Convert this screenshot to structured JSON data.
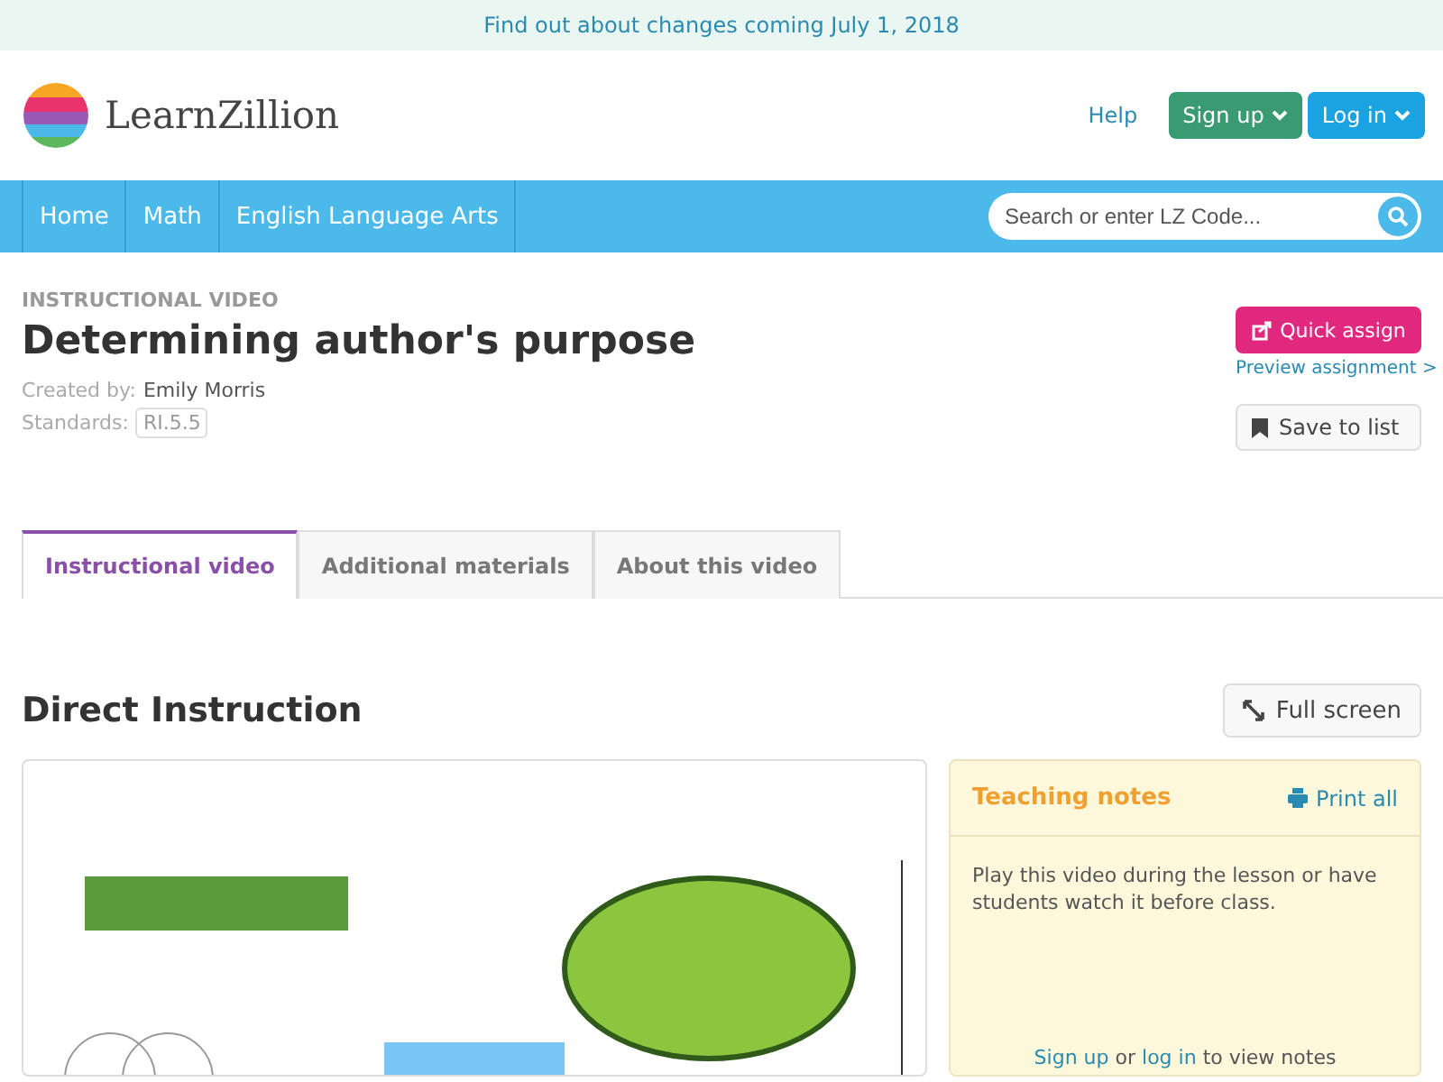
{
  "banner": {
    "text": "Find out about changes coming July 1, 2018"
  },
  "header": {
    "logo_text": "LearnZillion",
    "help": "Help",
    "signup": "Sign up",
    "login": "Log in"
  },
  "nav": {
    "items": [
      "Home",
      "Math",
      "English Language Arts"
    ],
    "search": {
      "placeholder": "Search or enter LZ Code..."
    }
  },
  "lesson": {
    "type": "INSTRUCTIONAL VIDEO",
    "title": "Determining author's purpose",
    "created_label": "Created by:",
    "author": "Emily Morris",
    "standards_label": "Standards:",
    "standard": "RI.5.5",
    "quick_assign": "Quick assign",
    "preview": "Preview assignment >",
    "save": "Save to list"
  },
  "tabs": [
    {
      "label": "Instructional video",
      "selected": true
    },
    {
      "label": "Additional materials",
      "selected": false
    },
    {
      "label": "About this video",
      "selected": false
    }
  ],
  "section": {
    "title": "Direct Instruction",
    "full_screen": "Full screen"
  },
  "notes": {
    "title": "Teaching notes",
    "print": "Print all",
    "body": "Play this video during the lesson or have students watch it before class.",
    "signup_link": "Sign up",
    "middle": "or",
    "login_link": "log in",
    "rest": "to view notes"
  }
}
